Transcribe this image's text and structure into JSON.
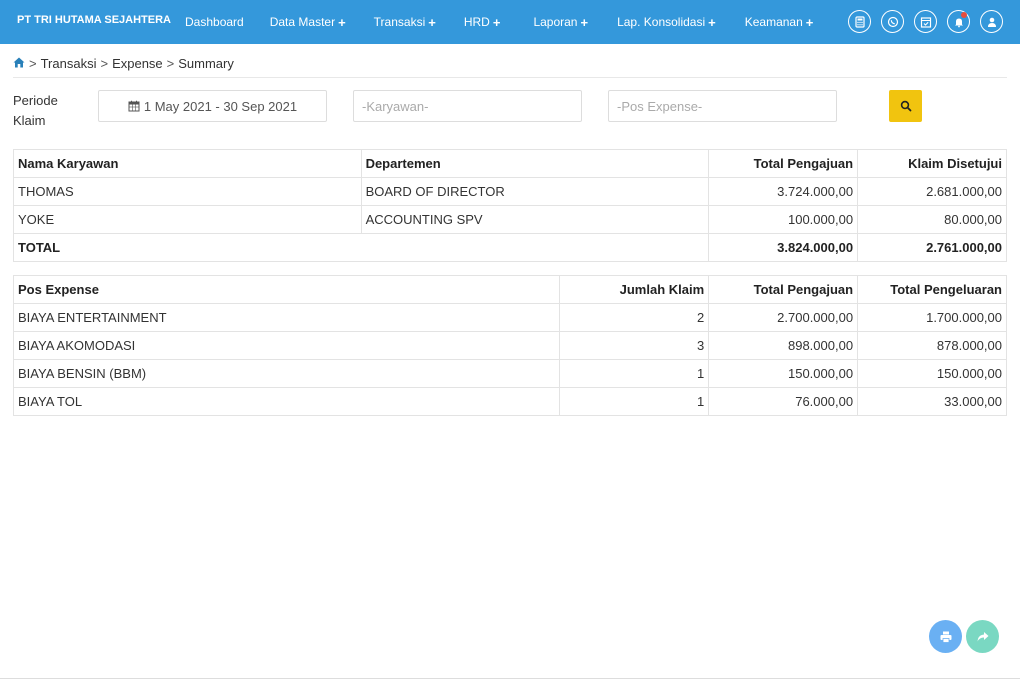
{
  "app": {
    "brand": "PT TRI HUTAMA SEJAHTERA"
  },
  "nav": {
    "items": [
      {
        "label": "Dashboard",
        "has_plus": false
      },
      {
        "label": "Data Master",
        "has_plus": true
      },
      {
        "label": "Transaksi",
        "has_plus": true
      },
      {
        "label": "HRD",
        "has_plus": true
      },
      {
        "label": "Laporan",
        "has_plus": true
      },
      {
        "label": "Lap. Konsolidasi",
        "has_plus": true
      },
      {
        "label": "Keamanan",
        "has_plus": true
      }
    ],
    "plus_symbol": "+",
    "icons": [
      "calculator-icon",
      "whatsapp-icon",
      "calendar-check-icon",
      "bell-icon",
      "user-icon"
    ]
  },
  "breadcrumb": {
    "home_icon": "home-icon",
    "items": [
      "Transaksi",
      "Expense",
      "Summary"
    ],
    "separator": ">"
  },
  "filters": {
    "label": "Periode Klaim",
    "date_range": "1 May 2021 - 30 Sep 2021",
    "karyawan_placeholder": "-Karyawan-",
    "pos_placeholder": "-Pos Expense-",
    "search_icon": "search-icon",
    "accent_color": "#f1c40f"
  },
  "employee_table": {
    "headers": [
      "Nama Karyawan",
      "Departemen",
      "Total Pengajuan",
      "Klaim Disetujui"
    ],
    "rows": [
      [
        "THOMAS",
        "BOARD OF DIRECTOR",
        "3.724.000,00",
        "2.681.000,00"
      ],
      [
        "YOKE",
        "ACCOUNTING SPV",
        "100.000,00",
        "80.000,00"
      ]
    ],
    "total": {
      "label": "TOTAL",
      "pengajuan": "3.824.000,00",
      "disetujui": "2.761.000,00"
    }
  },
  "pos_table": {
    "headers": [
      "Pos Expense",
      "Jumlah Klaim",
      "Total Pengajuan",
      "Total Pengeluaran"
    ],
    "rows": [
      [
        "BIAYA ENTERTAINMENT",
        "2",
        "2.700.000,00",
        "1.700.000,00"
      ],
      [
        "BIAYA AKOMODASI",
        "3",
        "898.000,00",
        "878.000,00"
      ],
      [
        "BIAYA BENSIN (BBM)",
        "1",
        "150.000,00",
        "150.000,00"
      ],
      [
        "BIAYA TOL",
        "1",
        "76.000,00",
        "33.000,00"
      ]
    ]
  },
  "fabs": {
    "print_icon": "print-icon",
    "share_icon": "share-icon"
  },
  "colors": {
    "navbar": "#3498db",
    "print_fab": "#6ab0f3",
    "share_fab": "#7ad8c2"
  }
}
